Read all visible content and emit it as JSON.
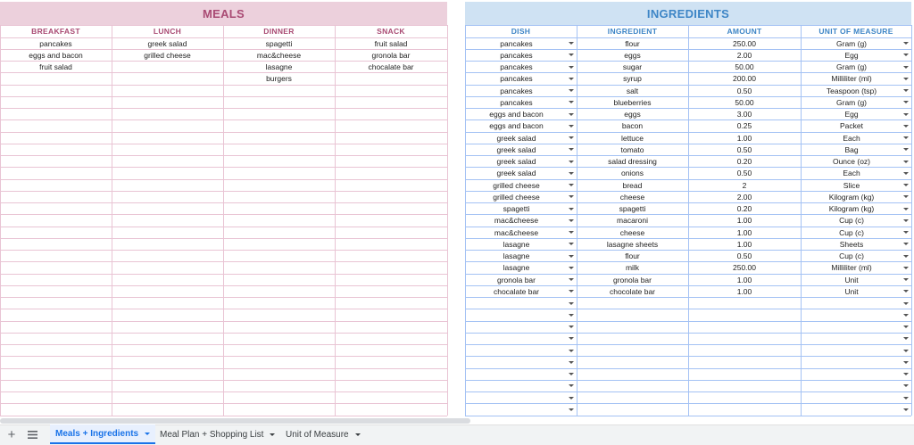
{
  "meals": {
    "title": "MEALS",
    "columns": [
      "BREAKFAST",
      "LUNCH",
      "DINNER",
      "SNACK"
    ],
    "rows": [
      [
        "pancakes",
        "greek salad",
        "spagetti",
        "fruit salad"
      ],
      [
        "eggs and bacon",
        "grilled cheese",
        "mac&cheese",
        "gronola bar"
      ],
      [
        "fruit salad",
        "",
        "lasagne",
        "chocalate bar"
      ],
      [
        "",
        "",
        "burgers",
        ""
      ]
    ]
  },
  "ingredients": {
    "title": "INGREDIENTS",
    "columns": [
      "DISH",
      "INGREDIENT",
      "AMOUNT",
      "UNIT OF MEASURE"
    ],
    "rows": [
      [
        "pancakes",
        "flour",
        "250.00",
        "Gram (g)"
      ],
      [
        "pancakes",
        "eggs",
        "2.00",
        "Egg"
      ],
      [
        "pancakes",
        "sugar",
        "50.00",
        "Gram (g)"
      ],
      [
        "pancakes",
        "syrup",
        "200.00",
        "Milliliter (ml)"
      ],
      [
        "pancakes",
        "salt",
        "0.50",
        "Teaspoon (tsp)"
      ],
      [
        "pancakes",
        "blueberries",
        "50.00",
        "Gram (g)"
      ],
      [
        "eggs and bacon",
        "eggs",
        "3.00",
        "Egg"
      ],
      [
        "eggs and bacon",
        "bacon",
        "0.25",
        "Packet"
      ],
      [
        "greek salad",
        "lettuce",
        "1.00",
        "Each"
      ],
      [
        "greek salad",
        "tomato",
        "0.50",
        "Bag"
      ],
      [
        "greek salad",
        "salad dressing",
        "0.20",
        "Ounce (oz)"
      ],
      [
        "greek salad",
        "onions",
        "0.50",
        "Each"
      ],
      [
        "grilled cheese",
        "bread",
        "2",
        "Slice"
      ],
      [
        "grilled cheese",
        "cheese",
        "2.00",
        "Kilogram (kg)"
      ],
      [
        "spagetti",
        "spagetti",
        "0.20",
        "Kilogram (kg)"
      ],
      [
        "mac&cheese",
        "macaroni",
        "1.00",
        "Cup (c)"
      ],
      [
        "mac&cheese",
        "cheese",
        "1.00",
        "Cup (c)"
      ],
      [
        "lasagne",
        "lasagne sheets",
        "1.00",
        "Sheets"
      ],
      [
        "lasagne",
        "flour",
        "0.50",
        "Cup (c)"
      ],
      [
        "lasagne",
        "milk",
        "250.00",
        "Milliliter (ml)"
      ],
      [
        "gronola bar",
        "gronola bar",
        "1.00",
        "Unit"
      ],
      [
        "chocalate bar",
        "chocolate bar",
        "1.00",
        "Unit"
      ]
    ]
  },
  "tabs": [
    {
      "label": "Meals + Ingredients",
      "active": true
    },
    {
      "label": "Meal Plan + Shopping List",
      "active": false
    },
    {
      "label": "Unit of Measure",
      "active": false
    }
  ],
  "icons": {
    "add": "plus-icon",
    "menu": "all-sheets-icon"
  },
  "colors": {
    "meals_header_bg": "#ecd0dc",
    "meals_header_text": "#a94a73",
    "meals_grid": "#e9c4d4",
    "ingredients_header_bg": "#cfe2f3",
    "ingredients_header_text": "#3d85c6",
    "ingredients_grid": "#a4c2f4",
    "active_tab": "#1a73e8"
  }
}
